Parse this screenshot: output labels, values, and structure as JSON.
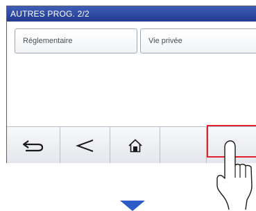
{
  "title": "AUTRES PROG. 2/2",
  "options": [
    {
      "label": "Réglementaire"
    },
    {
      "label": "Vie privée"
    }
  ],
  "toolbar": {
    "buttons": [
      {
        "icon": "back-icon"
      },
      {
        "icon": "previous-icon"
      },
      {
        "icon": "home-icon"
      },
      {
        "icon": "blank"
      }
    ]
  },
  "colors": {
    "titlebar": "#2d4aa3",
    "highlight": "#e0202a",
    "arrow": "#2a5bc7"
  }
}
